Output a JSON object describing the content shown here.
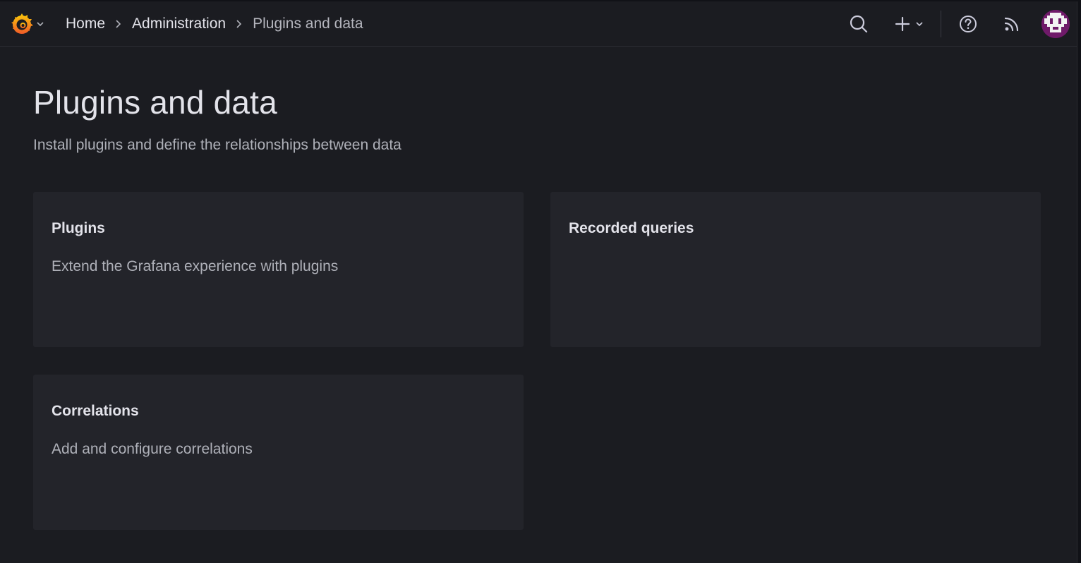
{
  "topbar": {
    "logo_icon": "grafana-logo-icon",
    "breadcrumb": [
      {
        "label": "Home"
      },
      {
        "label": "Administration"
      },
      {
        "label": "Plugins and data"
      }
    ],
    "icons": [
      "search-icon",
      "plus-icon",
      "help-icon",
      "rss-icon",
      "avatar"
    ]
  },
  "page": {
    "title": "Plugins and data",
    "subtitle": "Install plugins and define the relationships between data"
  },
  "cards": [
    {
      "title": "Plugins",
      "description": "Extend the Grafana experience with plugins"
    },
    {
      "title": "Recorded queries",
      "description": ""
    },
    {
      "title": "Correlations",
      "description": "Add and configure correlations"
    }
  ],
  "colors": {
    "background": "#1b1c21",
    "card": "#23242a",
    "accent_orange": "#f46800",
    "avatar": "#6f1a69"
  }
}
